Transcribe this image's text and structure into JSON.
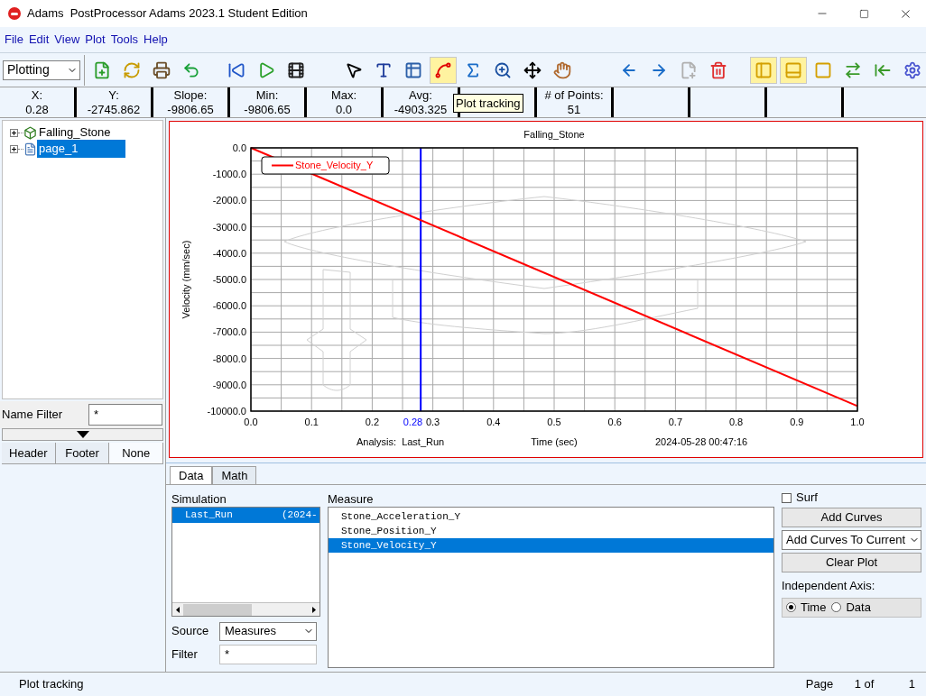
{
  "window": {
    "title": "Adams  PostProcessor Adams 2023.1 Student Edition"
  },
  "menu": [
    "File",
    "Edit",
    "View",
    "Plot",
    "Tools",
    "Help"
  ],
  "toolbar": {
    "mode": "Plotting",
    "tool_groups": [
      [
        {
          "kind": "new-plot",
          "selected": false
        },
        {
          "kind": "reload",
          "selected": false
        },
        {
          "kind": "print",
          "selected": false
        },
        {
          "kind": "undo",
          "selected": false
        }
      ],
      [
        {
          "kind": "rewind",
          "selected": false
        },
        {
          "kind": "play",
          "selected": false
        },
        {
          "kind": "animation",
          "selected": false
        }
      ],
      [
        {
          "kind": "select",
          "selected": false
        },
        {
          "kind": "text",
          "selected": false
        },
        {
          "kind": "table",
          "selected": false
        },
        {
          "kind": "tracking",
          "selected": true
        },
        {
          "kind": "statistics",
          "selected": false
        },
        {
          "kind": "zoom",
          "selected": false
        },
        {
          "kind": "fit",
          "selected": false
        },
        {
          "kind": "pan",
          "selected": false
        }
      ],
      [
        {
          "kind": "previous-page",
          "selected": false
        },
        {
          "kind": "next-page",
          "selected": false
        },
        {
          "kind": "new-page",
          "selected": false
        },
        {
          "kind": "delete-page",
          "selected": false
        }
      ],
      [
        {
          "kind": "tree-panel",
          "selected": true
        },
        {
          "kind": "data-panel",
          "selected": true
        },
        {
          "kind": "fill",
          "selected": false
        },
        {
          "kind": "swap",
          "selected": false
        },
        {
          "kind": "exit",
          "selected": false
        },
        {
          "kind": "settings",
          "selected": false
        }
      ]
    ]
  },
  "readouts": [
    {
      "label": "X:",
      "value": "0.28"
    },
    {
      "label": "Y:",
      "value": "-2745.862"
    },
    {
      "label": "Slope:",
      "value": "-9806.65"
    },
    {
      "label": "Min:",
      "value": "-9806.65"
    },
    {
      "label": "Max:",
      "value": "0.0"
    },
    {
      "label": "Avg:",
      "value": "-4903.325"
    },
    {
      "label": "# of Points:",
      "value": "51"
    }
  ],
  "tooltip": "Plot tracking",
  "tree": [
    {
      "label": "Falling_Stone",
      "kind": "model",
      "expanded": false,
      "selected": false
    },
    {
      "label": "page_1",
      "kind": "page",
      "expanded": false,
      "selected": true
    }
  ],
  "name_filter": {
    "label": "Name Filter",
    "value": "*"
  },
  "layout_tabs": [
    {
      "label": "Header",
      "selected": false
    },
    {
      "label": "Footer",
      "selected": false
    },
    {
      "label": "None",
      "selected": true
    }
  ],
  "plot": {
    "analysis": "Analysis:  Last_Run",
    "timestamp": "2024-05-28 00:47:16",
    "chart_data": {
      "type": "line",
      "title": "Falling_Stone",
      "xlabel": "Time (sec)",
      "ylabel": "Velocity (mm/sec)",
      "x": [
        0,
        1
      ],
      "series": [
        {
          "name": "Stone_Velocity_Y",
          "color": "#ff0000",
          "values": [
            0,
            -9810
          ]
        }
      ],
      "xlim": [
        0,
        1
      ],
      "ylim": [
        -10000,
        0
      ],
      "grid": true,
      "ref_lines": [
        {
          "axis": "x",
          "value": 0.28,
          "label": "0.28",
          "color": "#0000ff"
        }
      ],
      "xticks": [
        {
          "value": 0,
          "label": "0.0"
        },
        {
          "value": 0.1,
          "label": "0.1"
        },
        {
          "value": 0.2,
          "label": "0.2"
        },
        {
          "value": 0.3,
          "label": "0.3"
        },
        {
          "value": 0.4,
          "label": "0.4"
        },
        {
          "value": 0.5,
          "label": "0.5"
        },
        {
          "value": 0.6,
          "label": "0.6"
        },
        {
          "value": 0.7,
          "label": "0.7"
        },
        {
          "value": 0.8,
          "label": "0.8"
        },
        {
          "value": 0.9,
          "label": "0.9"
        },
        {
          "value": 1,
          "label": "1.0"
        }
      ],
      "yticks": [
        {
          "value": 0,
          "label": "0.0"
        },
        {
          "value": -1000,
          "label": "-1000.0"
        },
        {
          "value": -2000,
          "label": "-2000.0"
        },
        {
          "value": -3000,
          "label": "-3000.0"
        },
        {
          "value": -4000,
          "label": "-4000.0"
        },
        {
          "value": -5000,
          "label": "-5000.0"
        },
        {
          "value": -6000,
          "label": "-6000.0"
        },
        {
          "value": -7000,
          "label": "-7000.0"
        },
        {
          "value": -8000,
          "label": "-8000.0"
        },
        {
          "value": -9000,
          "label": "-9000.0"
        },
        {
          "value": -10000,
          "label": "-10000.0"
        }
      ]
    }
  },
  "data_panel": {
    "tabs": [
      {
        "label": "Data",
        "selected": true
      },
      {
        "label": "Math",
        "selected": false
      }
    ],
    "simulation": {
      "label": "Simulation",
      "items": [
        {
          "name": "Last_Run",
          "detail": "(2024-",
          "selected": true
        }
      ]
    },
    "source": {
      "label": "Source",
      "value": "Measures"
    },
    "filter": {
      "label": "Filter",
      "value": "*"
    },
    "measure": {
      "label": "Measure",
      "items": [
        {
          "name": "Stone_Acceleration_Y",
          "selected": false
        },
        {
          "name": "Stone_Position_Y",
          "selected": false
        },
        {
          "name": "Stone_Velocity_Y",
          "selected": true
        }
      ]
    },
    "surf": {
      "label": "Surf",
      "checked": false
    },
    "add_curves": "Add Curves",
    "add_mode": "Add Curves To Current",
    "clear_plot": "Clear Plot",
    "independent_axis": {
      "label": "Independent Axis:",
      "options": [
        {
          "label": "Time",
          "selected": true
        },
        {
          "label": "Data",
          "selected": false
        }
      ]
    }
  },
  "status_bar": {
    "message": "Plot tracking",
    "page_label": "Page",
    "page": "1 of",
    "pages": "1"
  }
}
